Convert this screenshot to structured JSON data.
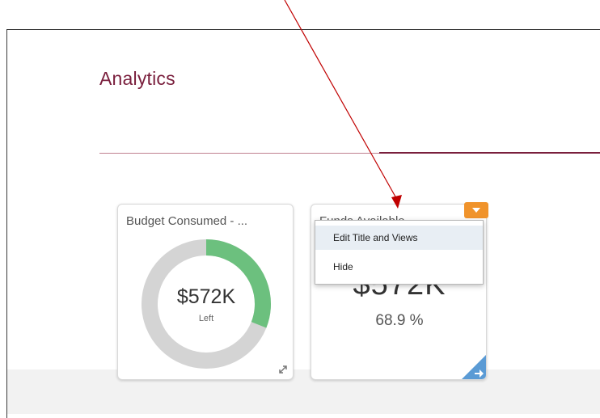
{
  "header": {
    "title": "Analytics"
  },
  "tiles": [
    {
      "title": "Budget Consumed - ...",
      "value": "$572K",
      "sublabel": "Left",
      "donut": {
        "consumed_fraction": 0.31,
        "colors": {
          "consumed": "#6cc07e",
          "remaining": "#d4d4d4"
        }
      }
    },
    {
      "title": "Funds Available",
      "value": "$572K",
      "percent": "68.9 %"
    }
  ],
  "context_menu": {
    "items": [
      {
        "label": "Edit Title and Views",
        "highlighted": true
      },
      {
        "label": "Hide",
        "highlighted": false
      }
    ]
  },
  "colors": {
    "accent": "#7a1f3d",
    "menu_button": "#f0932b",
    "corner_badge": "#5b9bd5",
    "annotation_arrow": "#c00000"
  }
}
